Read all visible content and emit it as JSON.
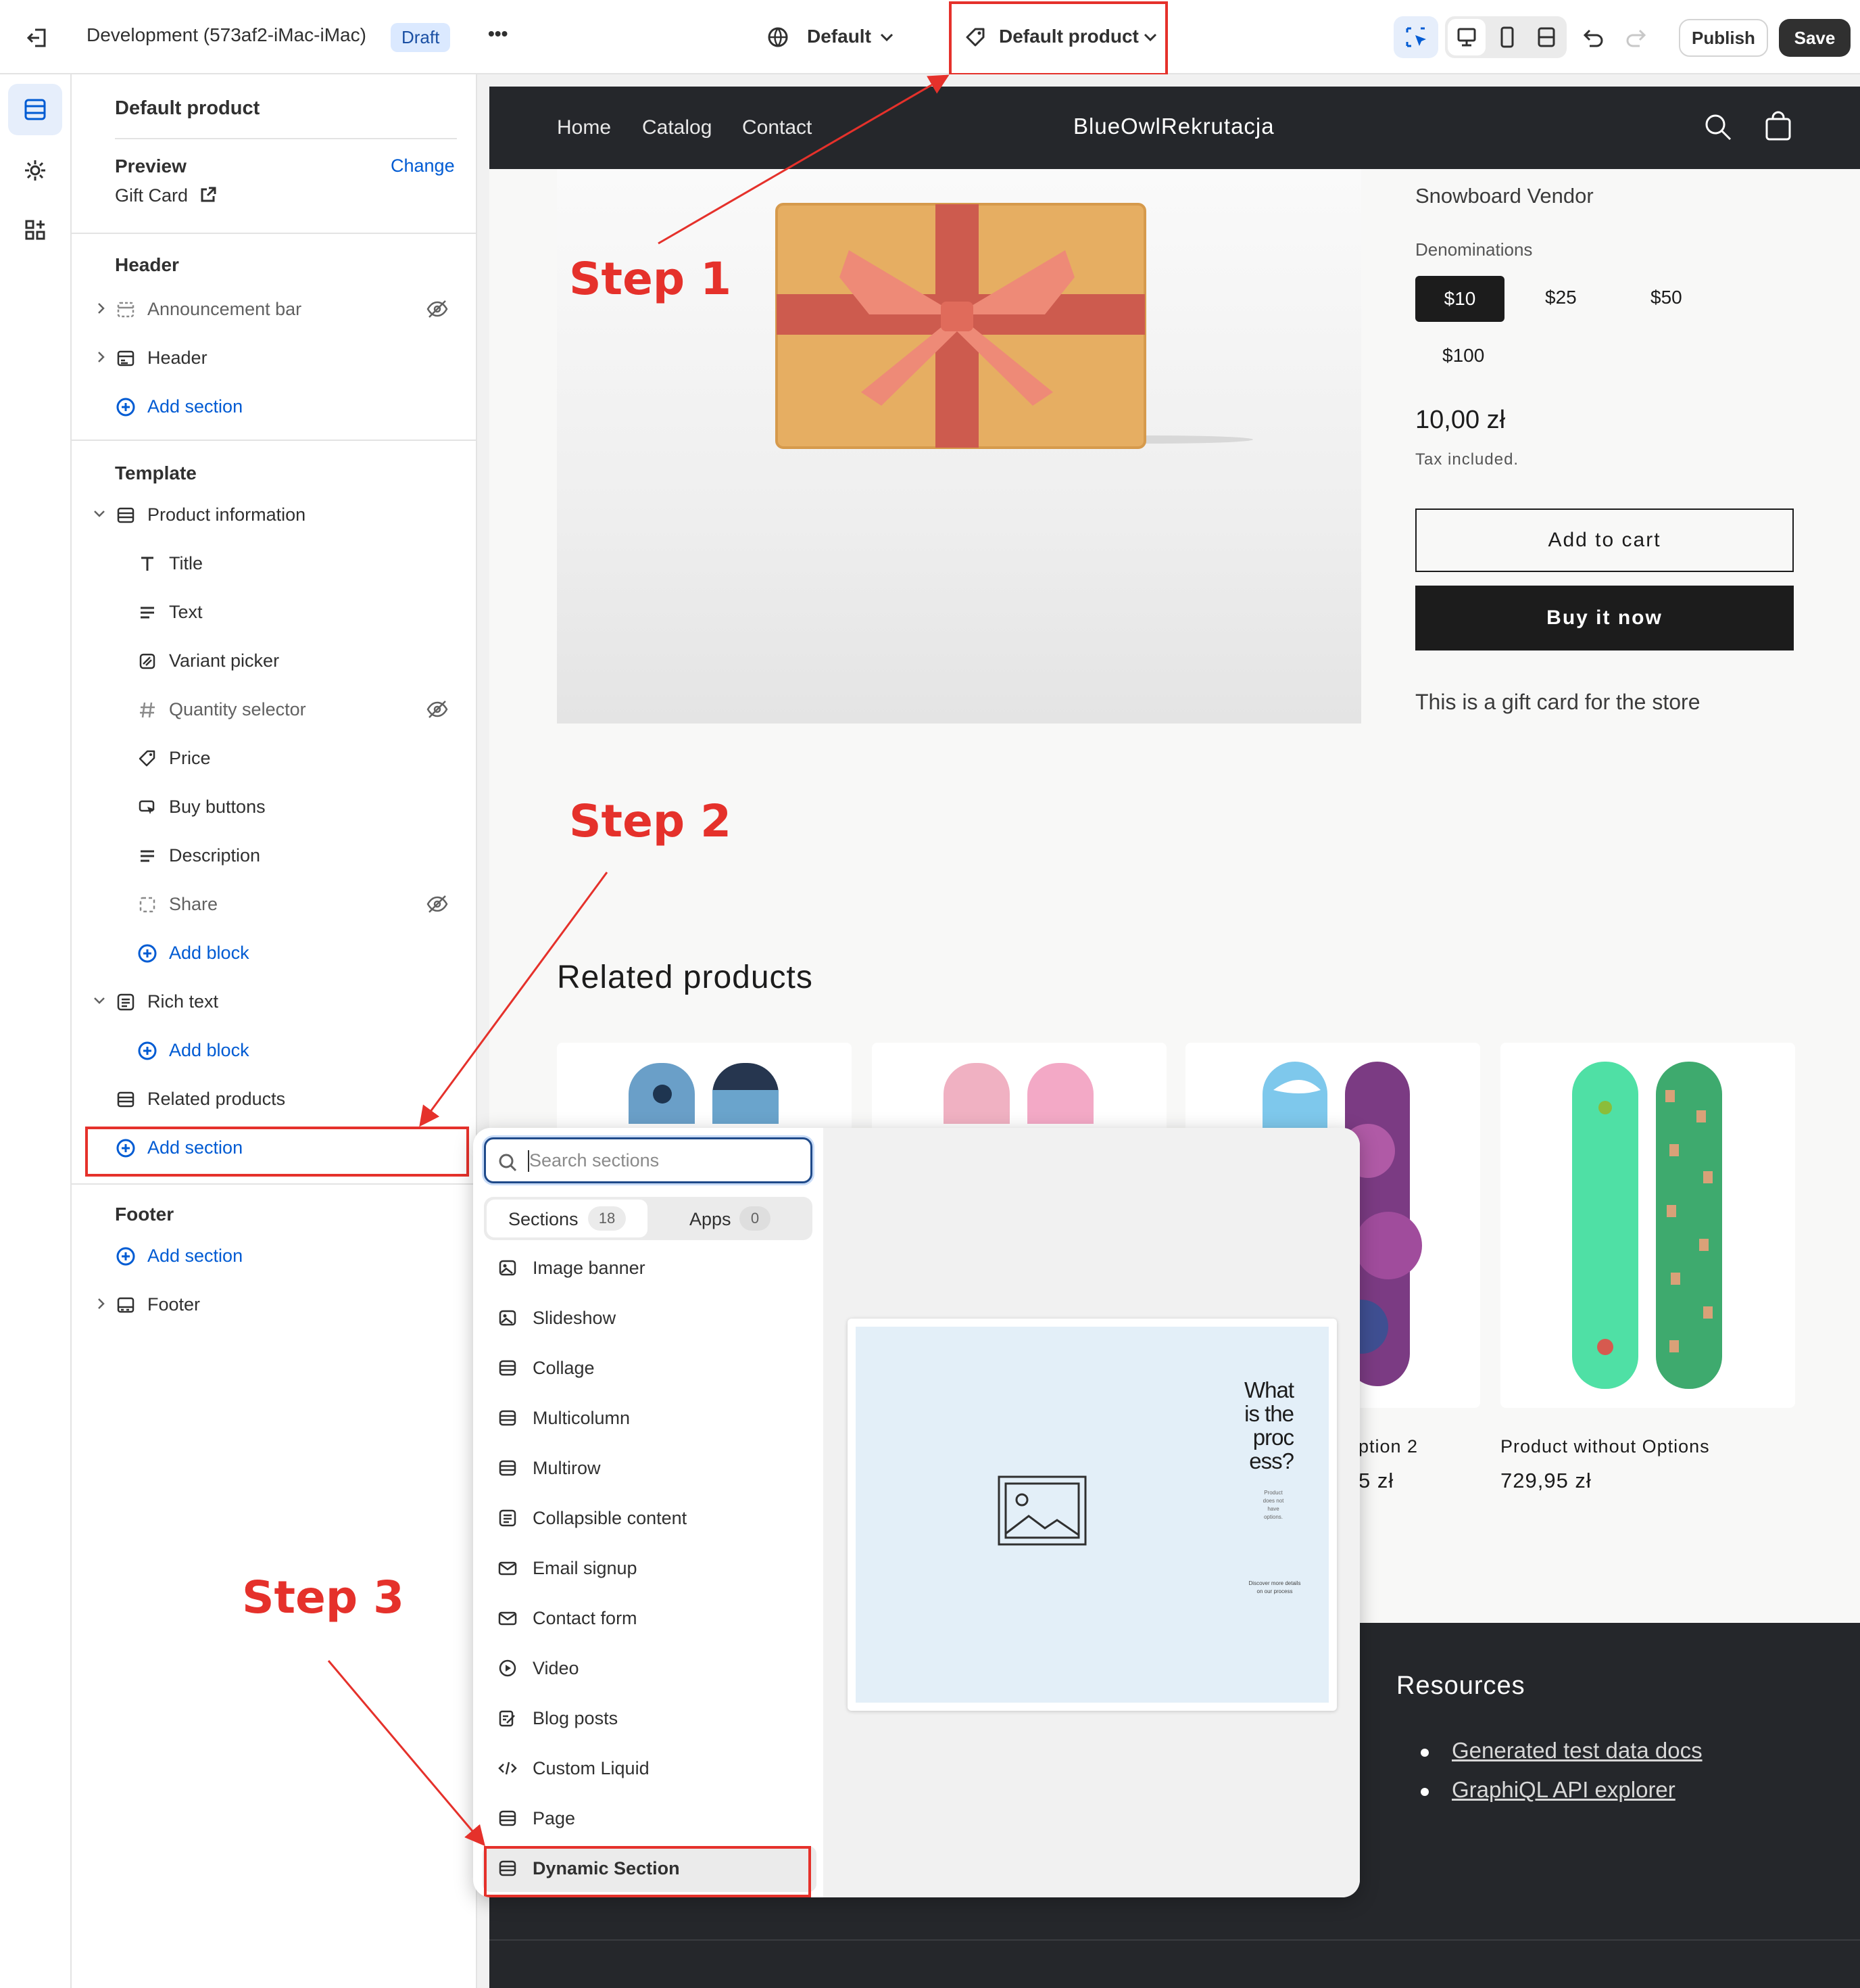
{
  "topbar": {
    "store_name": "Development (573af2-iMac-iMac)",
    "status_badge": "Draft",
    "more_label": "•••",
    "theme_selector": "Default",
    "template_selector": "Default product",
    "publish_label": "Publish",
    "save_label": "Save"
  },
  "sidebar": {
    "title": "Default product",
    "preview_label": "Preview",
    "preview_value": "Gift Card",
    "change_label": "Change",
    "header_group": {
      "heading": "Header",
      "items": [
        "Announcement bar",
        "Header"
      ],
      "add_section": "Add section"
    },
    "template_group": {
      "heading": "Template",
      "product_information": "Product information",
      "blocks": [
        "Title",
        "Text",
        "Variant picker",
        "Quantity selector",
        "Price",
        "Buy buttons",
        "Description",
        "Share"
      ],
      "add_block": "Add block",
      "rich_text": "Rich text",
      "add_block_2": "Add block",
      "related_products": "Related products",
      "add_section": "Add section"
    },
    "footer_group": {
      "heading": "Footer",
      "add_section": "Add section",
      "footer_item": "Footer"
    }
  },
  "store": {
    "nav": [
      "Home",
      "Catalog",
      "Contact"
    ],
    "brand": "BlueOwlRekrutacja",
    "vendor": "Snowboard Vendor",
    "denominations_label": "Denominations",
    "denominations": [
      "$10",
      "$25",
      "$50",
      "$100"
    ],
    "selected_denomination": "$10",
    "price": "10,00 zł",
    "tax_note": "Tax included.",
    "add_to_cart": "Add to cart",
    "buy_now": "Buy it now",
    "description": "This is a gift card for the store",
    "related_heading": "Related products",
    "product_3_name_partial": "ption 2",
    "product_3_price_partial": "5 zł",
    "product_4_name": "Product without Options",
    "product_4_price": "729,95 zł",
    "footer_heading": "Resources",
    "footer_links": [
      "Generated test data docs",
      "GraphiQL API explorer"
    ]
  },
  "popup": {
    "search_placeholder": "Search sections",
    "tab_sections": "Sections",
    "tab_sections_count": "18",
    "tab_apps": "Apps",
    "tab_apps_count": "0",
    "items": [
      "Image banner",
      "Slideshow",
      "Collage",
      "Multicolumn",
      "Multirow",
      "Collapsible content",
      "Email signup",
      "Contact form",
      "Video",
      "Blog posts",
      "Custom Liquid",
      "Page",
      "Dynamic Section"
    ],
    "preview_heading": "What is the proc ess?",
    "preview_small": "Product does not have options.",
    "preview_link_text": "Discover more details on our process"
  },
  "annotations": {
    "step1": "Step 1",
    "step2": "Step 2",
    "step3": "Step 3"
  },
  "colors": {
    "accent_red": "#e5312b",
    "link_blue": "#005bd3",
    "store_dark": "#25272b"
  }
}
